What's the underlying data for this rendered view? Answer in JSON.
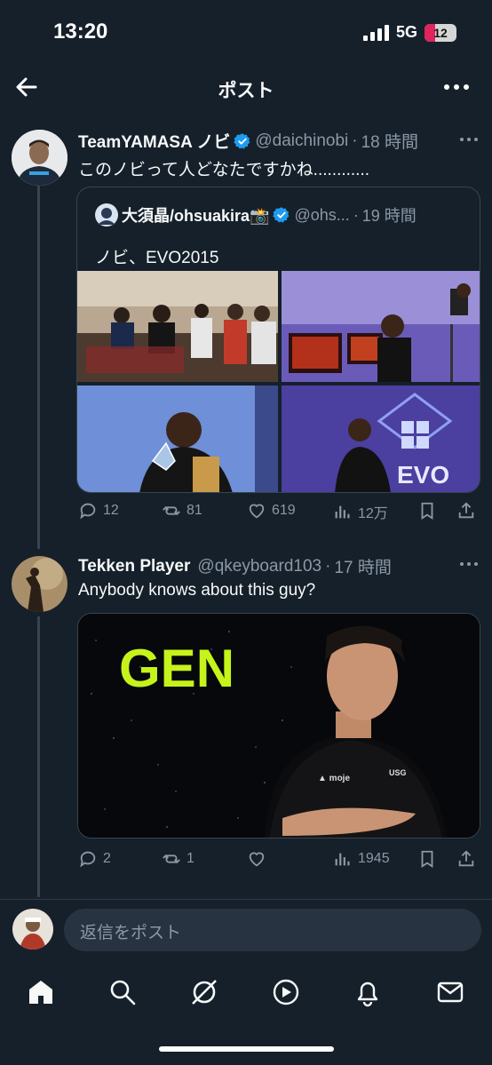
{
  "status_bar": {
    "time": "13:20",
    "network": "5G",
    "battery": "12"
  },
  "header": {
    "title": "ポスト"
  },
  "post1": {
    "name": "TeamYAMASA ノビ",
    "handle": "@daichinobi",
    "dot": "·",
    "time": "18 時間",
    "text": "このノビって人どなたですかね............",
    "quote": {
      "name": "大須晶/ohsuakira📸",
      "handle": "@ohs...",
      "dot": "·",
      "time": "19 時間",
      "text": "ノビ、EVO2015"
    },
    "actions": {
      "replies": "12",
      "reposts": "81",
      "likes": "619",
      "views": "12万"
    }
  },
  "post2": {
    "name": "Tekken Player",
    "handle": "@qkeyboard103",
    "dot": "·",
    "time": "17 時間",
    "text": "Anybody knows about this guy?",
    "image_text": "GEN",
    "actions": {
      "replies": "2",
      "reposts": "1",
      "likes": "",
      "views": "1945"
    }
  },
  "reply": {
    "placeholder": "返信をポスト"
  },
  "colors": {
    "background": "#15202b",
    "accent": "#1d9bf0",
    "muted": "#8b98a5",
    "gen_green": "#c6f31a"
  },
  "icons": [
    "back-icon",
    "more-icon",
    "verified-icon",
    "reply-icon",
    "repost-icon",
    "like-icon",
    "views-icon",
    "bookmark-icon",
    "share-icon",
    "home-icon",
    "search-icon",
    "grok-icon",
    "video-icon",
    "notifications-icon",
    "messages-icon"
  ]
}
